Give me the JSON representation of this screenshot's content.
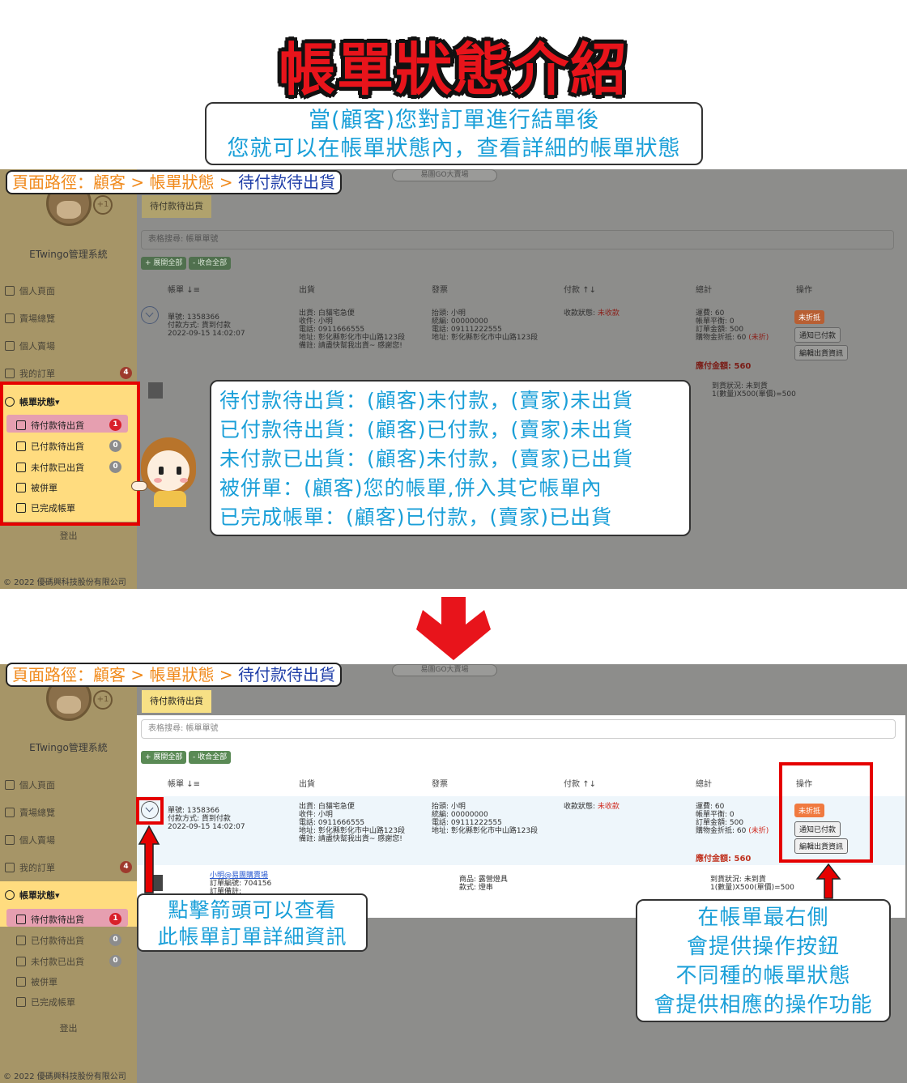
{
  "title": "帳單狀態介紹",
  "intro": {
    "line1": "當(顧客)您對訂單進行結單後",
    "line2": "您就可以在帳單狀態內，查看詳細的帳單狀態"
  },
  "breadcrumb": {
    "prefix": "頁面路徑：顧客 > 帳單狀態 > ",
    "current": "待付款待出貨"
  },
  "app": {
    "select": "易團GO大賣場",
    "system_name": "ETwingo管理系統",
    "nav": {
      "personal_page": "個人頁面",
      "market_overview": "賣場總覽",
      "personal_market": "個人賣場",
      "my_orders": "我的訂單",
      "my_orders_badge": "4",
      "bill_status": "帳單狀態",
      "pending_pay_ship": "待付款待出貨",
      "pending_pay_ship_badge": "1",
      "paid_pending_ship": "已付款待出貨",
      "paid_pending_ship_badge": "0",
      "unpaid_shipped": "未付款已出貨",
      "unpaid_shipped_badge": "0",
      "merged": "被併單",
      "completed": "已完成帳單"
    },
    "logout": "登出",
    "copyright": "© 2022 優碼興科技股份有限公司",
    "tab": "待付款待出貨",
    "search_placeholder": "表格搜尋: 帳單單號",
    "expand_all": "+ 展開全部",
    "collapse_all": "- 收合全部",
    "columns": {
      "bill": "帳單",
      "ship": "出貨",
      "invoice": "發票",
      "payment": "付款",
      "total": "總計",
      "actions": "操作"
    },
    "row": {
      "bill_no": "單號: 1358366",
      "pay_method": "付款方式: 貨到付款",
      "date": "2022-09-15 14:02:07",
      "ship_method": "出貨: 白貓宅急便",
      "recipient": "收件: 小明",
      "phone": "電話: 0911666555",
      "address": "地址: 彰化縣彰化市中山路123段",
      "note": "備註: 請盡快幫我出貨~ 感謝您!",
      "invoice_title": "抬頭: 小明",
      "tax_id": "統編: 00000000",
      "invoice_phone": "電話: 09111222555",
      "invoice_address": "地址: 彰化縣彰化市中山路123段",
      "pay_status_label": "收款狀態: ",
      "pay_status": "未收款",
      "shipping_fee": "運費: 60",
      "balance": "帳單平衡: 0",
      "order_amount": "訂單金額: 500",
      "discount": "購物金折抵: 60 ",
      "discount_status": "(未折)",
      "payable": "應付金額: 560",
      "btn_discount": "未折抵",
      "btn_notify_paid": "通知已付款",
      "btn_edit_ship": "編輯出貨資訊"
    },
    "detail": {
      "shop": "小明@易團購賣場",
      "order_no": "訂單編號: 704156",
      "order_note": "訂單備註:",
      "product": "商品: 露營燈具",
      "spec": "款式: 燈串",
      "arrival": "到貨狀況: 未到貨",
      "qty": "1(數量)X500(單價)=500"
    }
  },
  "status_list": [
    "待付款待出貨：(顧客)未付款，(賣家)未出貨",
    "已付款待出貨：(顧客)已付款，(賣家)未出貨",
    "未付款已出貨：(顧客)未付款，(賣家)已出貨",
    "被併單：(顧客)您的帳單,併入其它帳單內",
    "已完成帳單：(顧客)已付款，(賣家)已出貨"
  ],
  "note_left": {
    "line1": "點擊箭頭可以查看",
    "line2": "此帳單訂單詳細資訊"
  },
  "note_right": {
    "line1": "在帳單最右側",
    "line2": "會提供操作按鈕",
    "line3": "不同種的帳單狀態",
    "line4": "會提供相應的操作功能"
  },
  "colors": {
    "title_red": "#e8141b",
    "callout_blue": "#1a9fd8",
    "breadcrumb_orange": "#f08a1c",
    "breadcrumb_current": "#1f3ea8",
    "highlight_red": "#e50000"
  }
}
